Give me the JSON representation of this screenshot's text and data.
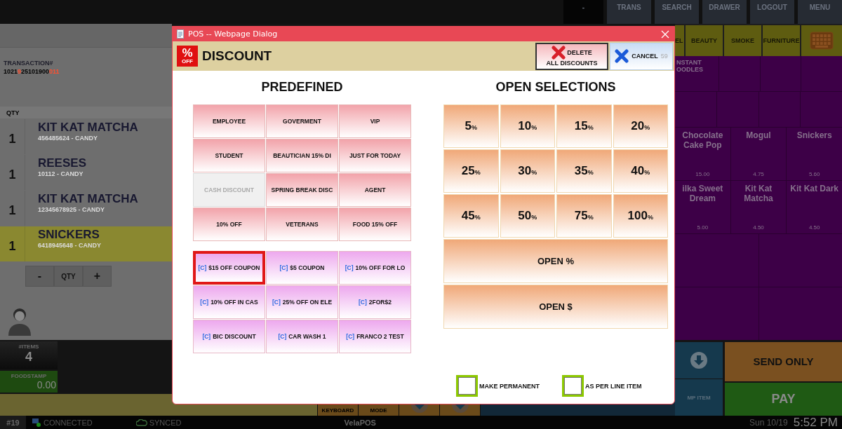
{
  "top_bar": {
    "buttons": [
      {
        "label": "-",
        "kind": "blank"
      },
      {
        "label": "TRANS",
        "kind": "menu"
      },
      {
        "label": "SEARCH",
        "kind": "menu"
      },
      {
        "label": "DRAWER",
        "kind": "menu"
      },
      {
        "label": "LOGOUT",
        "kind": "menu"
      },
      {
        "label": "MENU",
        "kind": "menu"
      }
    ]
  },
  "transaction": {
    "label": "TRANSACTION#",
    "number": [
      {
        "text": "1021",
        "highlight": false
      },
      {
        "text": "9",
        "highlight": true
      },
      {
        "text": "25101900",
        "highlight": false
      },
      {
        "text": "011",
        "highlight": true
      }
    ],
    "qty_header": "QTY"
  },
  "line_items": [
    {
      "qty": "1",
      "name": "KIT KAT MATCHA",
      "code": "456485624 - CANDY",
      "selected": false
    },
    {
      "qty": "1",
      "name": "REESES",
      "code": "10112 - CANDY",
      "selected": false
    },
    {
      "qty": "1",
      "name": "KIT KAT MATCHA",
      "code": "12345678925 - CANDY",
      "selected": false
    },
    {
      "qty": "1",
      "name": "SNICKERS",
      "code": "6418945648 - CANDY",
      "selected": true
    }
  ],
  "qty_controls": [
    "-",
    "QTY",
    "+"
  ],
  "counters": {
    "items_label": "#ITEMS",
    "items_value": "4",
    "foodstamp_label": "FOODSTAMP",
    "foodstamp_value": "0.00"
  },
  "categories": [
    "EL",
    "BEAUTY",
    "SMOKE",
    "FURNITURE"
  ],
  "product_rows": [
    {
      "kind": "short",
      "cells": [
        {
          "kind": "product",
          "name": "NSTANT\nOODLES"
        },
        {
          "kind": "empty"
        },
        {
          "kind": "empty"
        },
        {
          "kind": "empty"
        }
      ]
    },
    {
      "kind": "short",
      "cells": [
        {
          "kind": "empty"
        },
        {
          "kind": "empty"
        },
        {
          "kind": "empty"
        },
        {
          "kind": "empty"
        }
      ]
    },
    {
      "kind": "tall",
      "cells": [
        {
          "kind": "product",
          "name": "Chocolate Cake Pop",
          "price": "15.00"
        },
        {
          "kind": "product",
          "name": "Mogul",
          "price": "4.75"
        },
        {
          "kind": "product",
          "name": "Snickers",
          "price": "5.60"
        }
      ]
    },
    {
      "kind": "tall",
      "cells": [
        {
          "kind": "product",
          "name": "ilka Sweet Dream",
          "price": "5.00"
        },
        {
          "kind": "product",
          "name": "Kit Kat Matcha",
          "price": "4.50"
        },
        {
          "kind": "product",
          "name": "Kit Kat Dark",
          "price": "4.50"
        }
      ]
    },
    {
      "kind": "tall",
      "cells": [
        {
          "kind": "empty"
        },
        {
          "kind": "empty"
        }
      ]
    },
    {
      "kind": "tall",
      "cells": [
        {
          "kind": "empty"
        },
        {
          "kind": "empty"
        }
      ]
    }
  ],
  "bottom_strip": [
    {
      "kind": "text",
      "label": "KEYBOARD"
    },
    {
      "kind": "text",
      "label": "MODE"
    },
    {
      "kind": "arrow"
    },
    {
      "kind": "arrow"
    }
  ],
  "side_tiles": [
    {
      "kind": "arrow"
    },
    {
      "kind": "text",
      "label": "MP ITEM"
    }
  ],
  "send_button": "SEND ONLY",
  "pay_button": "PAY",
  "status_bar": {
    "register": "#19",
    "connection": "CONNECTED",
    "sync": "SYNCED",
    "brand": "VelaPOS",
    "day": "Sun 10/19",
    "time": "5:52 PM"
  },
  "dialog": {
    "title": "POS -- Webpage Dialog",
    "badge": {
      "symbol": "%",
      "label": "OFF"
    },
    "heading": "DISCOUNT",
    "delete_button": {
      "lines": [
        "DELETE",
        "ALL DISCOUNTS"
      ]
    },
    "cancel_button": {
      "label": "CANCEL",
      "shortcut": "59"
    },
    "predefined": {
      "heading": "PREDEFINED",
      "items": [
        {
          "label": "EMPLOYEE",
          "disabled": false,
          "selected": false
        },
        {
          "label": "GOVERMENT",
          "disabled": false,
          "selected": false
        },
        {
          "label": "VIP",
          "disabled": false,
          "selected": false
        },
        {
          "label": "STUDENT",
          "disabled": false,
          "selected": false
        },
        {
          "label": "BEAUTICIAN 15% DI",
          "disabled": false,
          "selected": false
        },
        {
          "label": "JUST FOR TODAY",
          "disabled": false,
          "selected": false
        },
        {
          "label": "CASH DISCOUNT",
          "disabled": true,
          "selected": false
        },
        {
          "label": "SPRING BREAK DISC",
          "disabled": false,
          "selected": false
        },
        {
          "label": "AGENT",
          "disabled": false,
          "selected": false
        },
        {
          "label": "10% OFF",
          "disabled": false,
          "selected": false
        },
        {
          "label": "VETERANS",
          "disabled": false,
          "selected": false
        },
        {
          "label": "FOOD 15% OFF",
          "disabled": false,
          "selected": false
        }
      ],
      "coupons": [
        {
          "tag": "[C]",
          "label": "$15 OFF COUPON",
          "selected": true
        },
        {
          "tag": "[C]",
          "label": "$5 COUPON",
          "selected": false
        },
        {
          "tag": "[C]",
          "label": "10% OFF FOR LO",
          "selected": false
        },
        {
          "tag": "[C]",
          "label": "10% OFF IN CAS",
          "selected": false
        },
        {
          "tag": "[C]",
          "label": "25% OFF ON ELE",
          "selected": false
        },
        {
          "tag": "[C]",
          "label": "2FOR$2",
          "selected": false
        },
        {
          "tag": "[C]",
          "label": "BIC DISCOUNT",
          "selected": false
        },
        {
          "tag": "[C]",
          "label": "CAR WASH 1",
          "selected": false
        },
        {
          "tag": "[C]",
          "label": "FRANCO 2 TEST",
          "selected": false
        }
      ]
    },
    "open_selections": {
      "heading": "OPEN SELECTIONS",
      "percents": [
        {
          "value": "5",
          "unit": "%"
        },
        {
          "value": "10",
          "unit": "%"
        },
        {
          "value": "15",
          "unit": "%"
        },
        {
          "value": "20",
          "unit": "%"
        },
        {
          "value": "25",
          "unit": "%"
        },
        {
          "value": "30",
          "unit": "%"
        },
        {
          "value": "35",
          "unit": "%"
        },
        {
          "value": "40",
          "unit": "%"
        },
        {
          "value": "45",
          "unit": "%"
        },
        {
          "value": "50",
          "unit": "%"
        },
        {
          "value": "75",
          "unit": "%"
        },
        {
          "value": "100",
          "unit": "%"
        }
      ],
      "custom": [
        "OPEN %",
        "OPEN $"
      ]
    },
    "options": [
      {
        "label": "MAKE PERMANENT",
        "checked": false
      },
      {
        "label": "AS PER LINE ITEM",
        "checked": false
      }
    ]
  }
}
